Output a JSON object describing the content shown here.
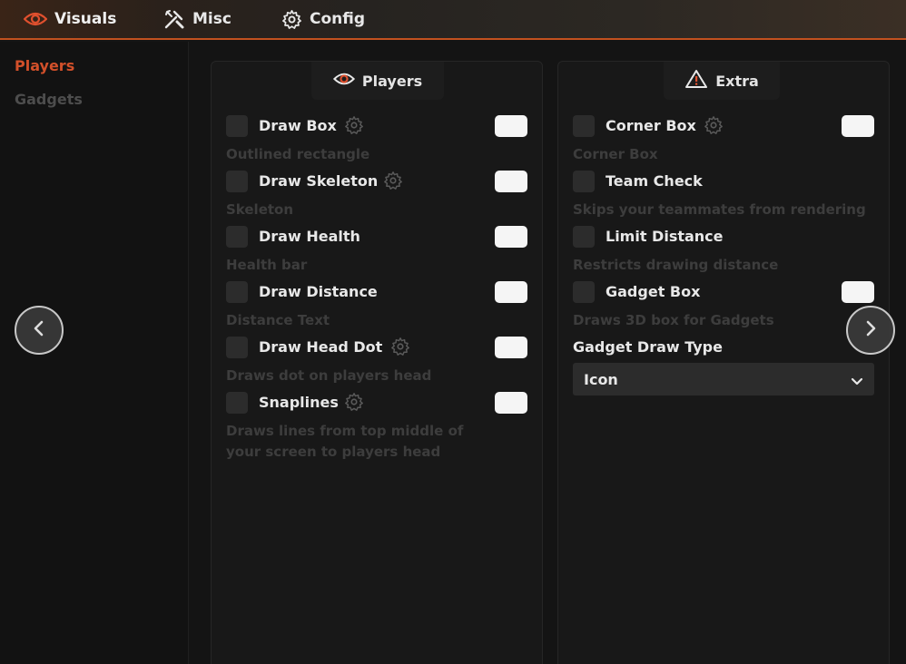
{
  "tabs": [
    {
      "label": "Visuals",
      "icon": "eye-icon"
    },
    {
      "label": "Misc",
      "icon": "tools-icon"
    },
    {
      "label": "Config",
      "icon": "gear-icon"
    }
  ],
  "sidebar": {
    "items": [
      {
        "label": "Players",
        "active": true
      },
      {
        "label": "Gadgets",
        "active": false
      }
    ]
  },
  "players_panel": {
    "title": "Players",
    "icon": "eye-icon",
    "options": [
      {
        "label": "Draw Box",
        "desc": "Outlined rectangle",
        "has_settings": true,
        "has_color": true
      },
      {
        "label": "Draw Skeleton",
        "desc": "Skeleton",
        "has_settings": true,
        "has_color": true
      },
      {
        "label": "Draw Health",
        "desc": "Health bar",
        "has_settings": false,
        "has_color": true
      },
      {
        "label": "Draw Distance",
        "desc": "Distance Text",
        "has_settings": false,
        "has_color": true
      },
      {
        "label": "Draw Head Dot",
        "desc": "Draws dot on players head",
        "has_settings": true,
        "has_color": true
      },
      {
        "label": "Snaplines",
        "desc": "Draws lines from top middle of",
        "desc2": "your screen to players head",
        "has_settings": true,
        "has_color": true
      }
    ]
  },
  "extra_panel": {
    "title": "Extra",
    "icon": "warning-icon",
    "options": [
      {
        "label": "Corner Box",
        "desc": "Corner Box",
        "has_settings": true,
        "has_color": true
      },
      {
        "label": "Team Check",
        "desc": "Skips your teammates from rendering",
        "has_settings": false,
        "has_color": false
      },
      {
        "label": "Limit Distance",
        "desc": "Restricts drawing distance",
        "has_settings": false,
        "has_color": false
      },
      {
        "label": "Gadget Box",
        "desc": "Draws 3D box for Gadgets",
        "has_settings": false,
        "has_color": true
      }
    ],
    "gadget_draw_type": {
      "label": "Gadget Draw Type",
      "value": "Icon"
    }
  },
  "colors": {
    "accent": "#d2502a",
    "background": "#141414",
    "panel": "#181818",
    "checkbox": "#2c2c2c",
    "swatch": "#f5f5f5"
  }
}
